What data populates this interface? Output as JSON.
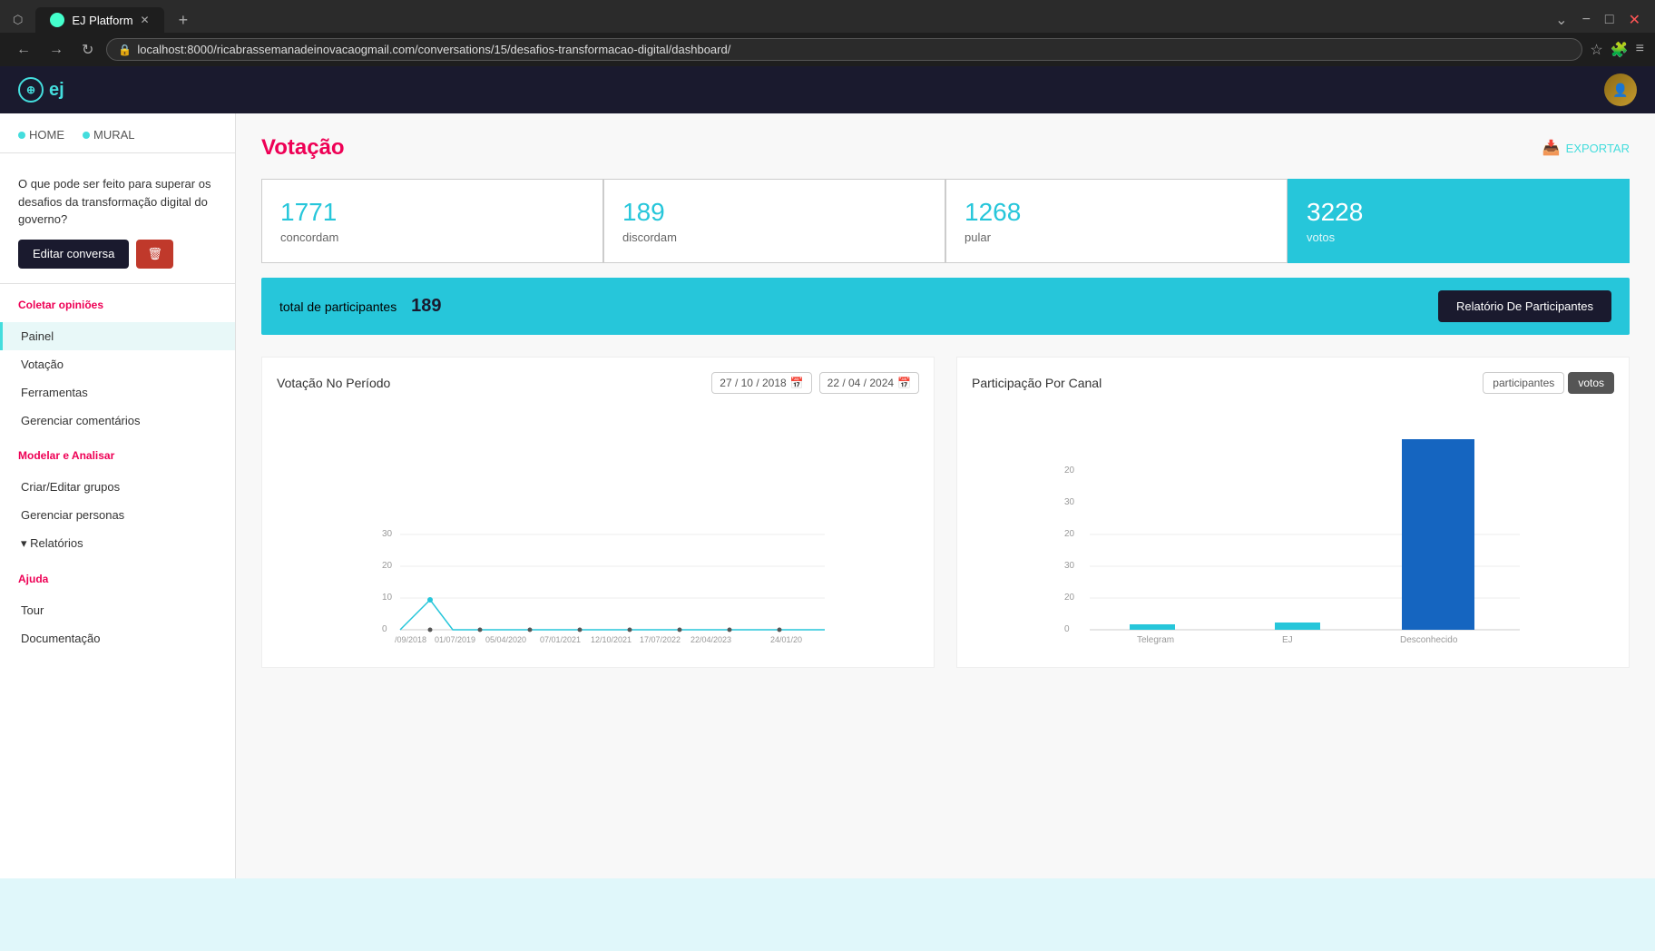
{
  "browser": {
    "tab_label": "EJ Platform",
    "url": "localhost:8000/ricabrassemanadeinovacaogmail.com/conversations/15/desafios-transformacao-digital/dashboard/",
    "new_tab_label": "+",
    "nav": {
      "back": "←",
      "forward": "→",
      "refresh": "↻"
    },
    "win_controls": {
      "minimize": "−",
      "maximize": "□",
      "close": "✕",
      "dropdown": "⌄"
    }
  },
  "header": {
    "logo_text": "ej",
    "home_label": "HOME",
    "mural_label": "MURAL"
  },
  "sidebar": {
    "conversation_text": "O que pode ser feito para superar os desafios da transformação digital do governo?",
    "edit_label": "Editar conversa",
    "delete_icon": "🗑",
    "sections": [
      {
        "title": "Coletar opiniões",
        "items": [
          {
            "label": "Painel",
            "active": true,
            "path": "sidebar-item-painel"
          },
          {
            "label": "Votação",
            "active": false,
            "path": "sidebar-item-votacao"
          },
          {
            "label": "Ferramentas",
            "active": false,
            "path": "sidebar-item-ferramentas"
          },
          {
            "label": "Gerenciar comentários",
            "active": false,
            "path": "sidebar-item-gerenciar-comentarios"
          }
        ]
      },
      {
        "title": "Modelar e Analisar",
        "items": [
          {
            "label": "Criar/Editar grupos",
            "active": false,
            "path": "sidebar-item-criar-editar-grupos"
          },
          {
            "label": "Gerenciar personas",
            "active": false,
            "path": "sidebar-item-gerenciar-personas"
          },
          {
            "label": "▾ Relatórios",
            "active": false,
            "path": "sidebar-item-relatorios"
          }
        ]
      },
      {
        "title": "Ajuda",
        "items": [
          {
            "label": "Tour",
            "active": false,
            "path": "sidebar-item-tour"
          },
          {
            "label": "Documentação",
            "active": false,
            "path": "sidebar-item-documentacao"
          }
        ]
      }
    ]
  },
  "main": {
    "page_title": "Votação",
    "export_label": "EXPORTAR",
    "stats": [
      {
        "number": "1771",
        "label": "concordam"
      },
      {
        "number": "189",
        "label": "discordam"
      },
      {
        "number": "1268",
        "label": "pular"
      },
      {
        "number": "3228",
        "label": "votos"
      }
    ],
    "participants": {
      "label": "total de participantes",
      "count": "189",
      "report_btn": "Relatório De Participantes"
    },
    "chart_votes": {
      "title": "Votação No Período",
      "date_start": "27 / 10 / 2018",
      "date_end": "22 / 04 / 2024",
      "x_labels": [
        "/09/2018",
        "01/07/2019",
        "05/04/2020",
        "07/01/2021",
        "12/10/2021",
        "17/07/2022",
        "22/04/2023",
        "24/01/20"
      ],
      "y_labels": [
        "0",
        "10",
        "20",
        "30"
      ],
      "accent_color": "#26c6da"
    },
    "chart_channel": {
      "title": "Participação Por Canal",
      "filter_participantes": "participantes",
      "filter_votos": "votos",
      "active_filter": "votos",
      "x_labels": [
        "Telegram",
        "EJ",
        "Desconhecido"
      ],
      "y_labels": [
        "0",
        "20",
        "30",
        "20",
        "30",
        "20"
      ],
      "bar_values": [
        2,
        5,
        100
      ],
      "bar_color": "#1565c0",
      "accent_color": "#26c6da"
    }
  }
}
